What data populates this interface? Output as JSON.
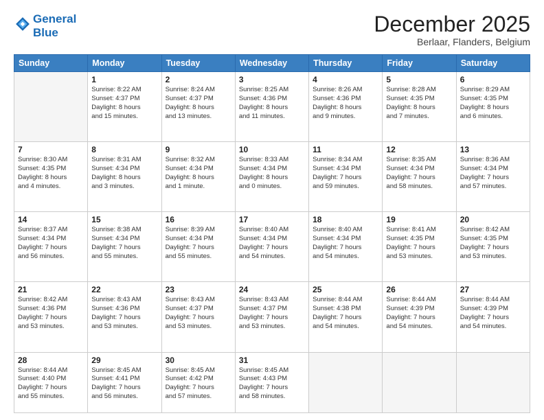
{
  "logo": {
    "line1": "General",
    "line2": "Blue"
  },
  "title": "December 2025",
  "location": "Berlaar, Flanders, Belgium",
  "days_header": [
    "Sunday",
    "Monday",
    "Tuesday",
    "Wednesday",
    "Thursday",
    "Friday",
    "Saturday"
  ],
  "weeks": [
    [
      {
        "day": "",
        "info": ""
      },
      {
        "day": "1",
        "info": "Sunrise: 8:22 AM\nSunset: 4:37 PM\nDaylight: 8 hours\nand 15 minutes."
      },
      {
        "day": "2",
        "info": "Sunrise: 8:24 AM\nSunset: 4:37 PM\nDaylight: 8 hours\nand 13 minutes."
      },
      {
        "day": "3",
        "info": "Sunrise: 8:25 AM\nSunset: 4:36 PM\nDaylight: 8 hours\nand 11 minutes."
      },
      {
        "day": "4",
        "info": "Sunrise: 8:26 AM\nSunset: 4:36 PM\nDaylight: 8 hours\nand 9 minutes."
      },
      {
        "day": "5",
        "info": "Sunrise: 8:28 AM\nSunset: 4:35 PM\nDaylight: 8 hours\nand 7 minutes."
      },
      {
        "day": "6",
        "info": "Sunrise: 8:29 AM\nSunset: 4:35 PM\nDaylight: 8 hours\nand 6 minutes."
      }
    ],
    [
      {
        "day": "7",
        "info": "Sunrise: 8:30 AM\nSunset: 4:35 PM\nDaylight: 8 hours\nand 4 minutes."
      },
      {
        "day": "8",
        "info": "Sunrise: 8:31 AM\nSunset: 4:34 PM\nDaylight: 8 hours\nand 3 minutes."
      },
      {
        "day": "9",
        "info": "Sunrise: 8:32 AM\nSunset: 4:34 PM\nDaylight: 8 hours\nand 1 minute."
      },
      {
        "day": "10",
        "info": "Sunrise: 8:33 AM\nSunset: 4:34 PM\nDaylight: 8 hours\nand 0 minutes."
      },
      {
        "day": "11",
        "info": "Sunrise: 8:34 AM\nSunset: 4:34 PM\nDaylight: 7 hours\nand 59 minutes."
      },
      {
        "day": "12",
        "info": "Sunrise: 8:35 AM\nSunset: 4:34 PM\nDaylight: 7 hours\nand 58 minutes."
      },
      {
        "day": "13",
        "info": "Sunrise: 8:36 AM\nSunset: 4:34 PM\nDaylight: 7 hours\nand 57 minutes."
      }
    ],
    [
      {
        "day": "14",
        "info": "Sunrise: 8:37 AM\nSunset: 4:34 PM\nDaylight: 7 hours\nand 56 minutes."
      },
      {
        "day": "15",
        "info": "Sunrise: 8:38 AM\nSunset: 4:34 PM\nDaylight: 7 hours\nand 55 minutes."
      },
      {
        "day": "16",
        "info": "Sunrise: 8:39 AM\nSunset: 4:34 PM\nDaylight: 7 hours\nand 55 minutes."
      },
      {
        "day": "17",
        "info": "Sunrise: 8:40 AM\nSunset: 4:34 PM\nDaylight: 7 hours\nand 54 minutes."
      },
      {
        "day": "18",
        "info": "Sunrise: 8:40 AM\nSunset: 4:34 PM\nDaylight: 7 hours\nand 54 minutes."
      },
      {
        "day": "19",
        "info": "Sunrise: 8:41 AM\nSunset: 4:35 PM\nDaylight: 7 hours\nand 53 minutes."
      },
      {
        "day": "20",
        "info": "Sunrise: 8:42 AM\nSunset: 4:35 PM\nDaylight: 7 hours\nand 53 minutes."
      }
    ],
    [
      {
        "day": "21",
        "info": "Sunrise: 8:42 AM\nSunset: 4:36 PM\nDaylight: 7 hours\nand 53 minutes."
      },
      {
        "day": "22",
        "info": "Sunrise: 8:43 AM\nSunset: 4:36 PM\nDaylight: 7 hours\nand 53 minutes."
      },
      {
        "day": "23",
        "info": "Sunrise: 8:43 AM\nSunset: 4:37 PM\nDaylight: 7 hours\nand 53 minutes."
      },
      {
        "day": "24",
        "info": "Sunrise: 8:43 AM\nSunset: 4:37 PM\nDaylight: 7 hours\nand 53 minutes."
      },
      {
        "day": "25",
        "info": "Sunrise: 8:44 AM\nSunset: 4:38 PM\nDaylight: 7 hours\nand 54 minutes."
      },
      {
        "day": "26",
        "info": "Sunrise: 8:44 AM\nSunset: 4:39 PM\nDaylight: 7 hours\nand 54 minutes."
      },
      {
        "day": "27",
        "info": "Sunrise: 8:44 AM\nSunset: 4:39 PM\nDaylight: 7 hours\nand 54 minutes."
      }
    ],
    [
      {
        "day": "28",
        "info": "Sunrise: 8:44 AM\nSunset: 4:40 PM\nDaylight: 7 hours\nand 55 minutes."
      },
      {
        "day": "29",
        "info": "Sunrise: 8:45 AM\nSunset: 4:41 PM\nDaylight: 7 hours\nand 56 minutes."
      },
      {
        "day": "30",
        "info": "Sunrise: 8:45 AM\nSunset: 4:42 PM\nDaylight: 7 hours\nand 57 minutes."
      },
      {
        "day": "31",
        "info": "Sunrise: 8:45 AM\nSunset: 4:43 PM\nDaylight: 7 hours\nand 58 minutes."
      },
      {
        "day": "",
        "info": ""
      },
      {
        "day": "",
        "info": ""
      },
      {
        "day": "",
        "info": ""
      }
    ]
  ]
}
